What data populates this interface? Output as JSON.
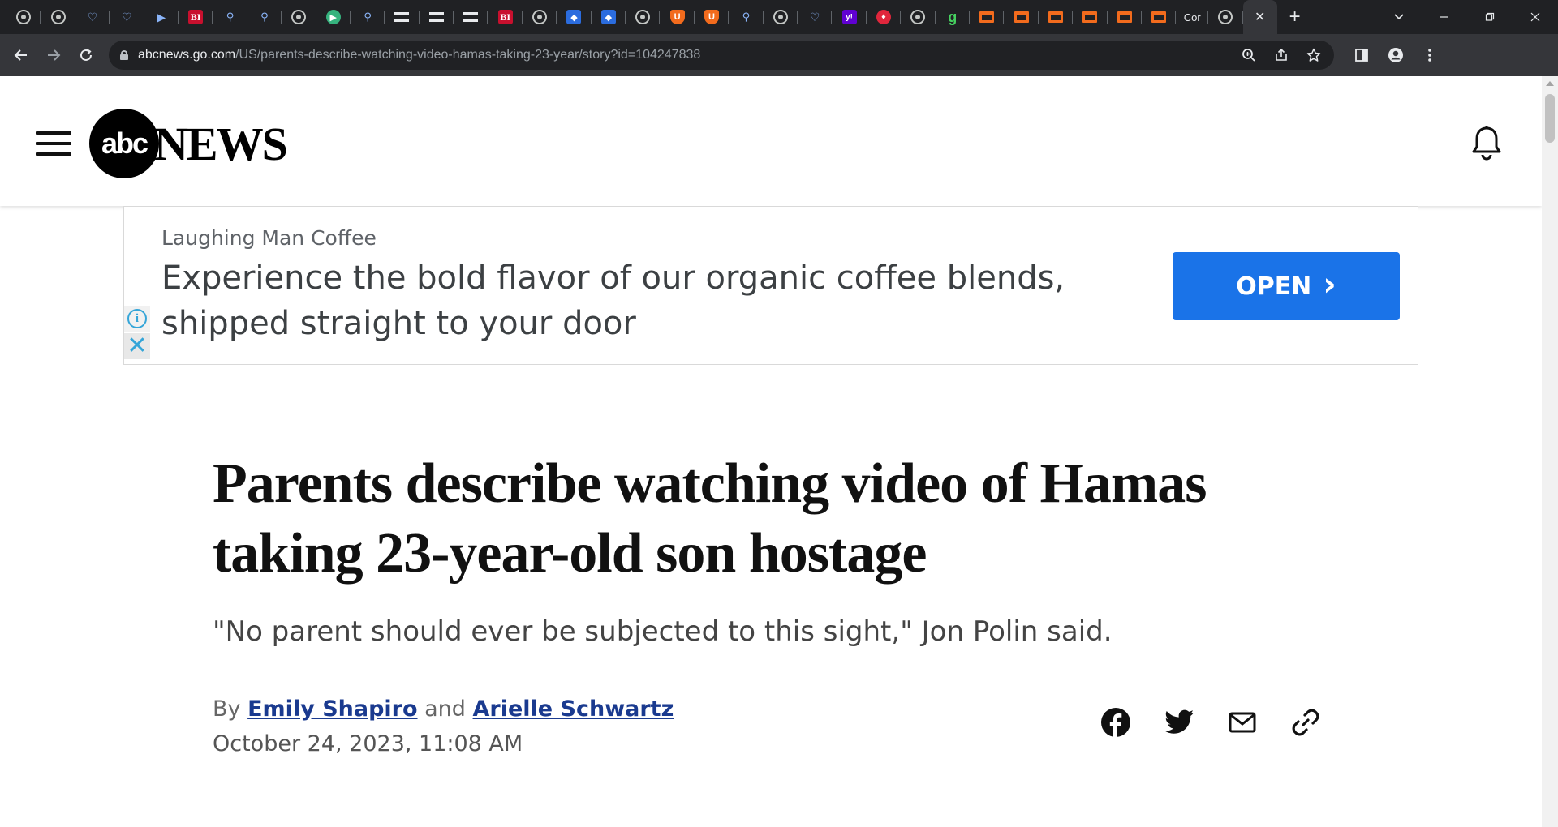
{
  "browser": {
    "tabs": [
      {
        "icon": "globe-icon",
        "glyph": ""
      },
      {
        "icon": "globe-icon",
        "glyph": ""
      },
      {
        "icon": "heart-icon",
        "glyph": "♡"
      },
      {
        "icon": "heart-icon",
        "glyph": "♡"
      },
      {
        "icon": "chevron-icon",
        "glyph": "▶"
      },
      {
        "icon": "business-insider-icon",
        "glyph": "BI"
      },
      {
        "icon": "search-icon",
        "glyph": "⚲"
      },
      {
        "icon": "search-icon",
        "glyph": "⚲"
      },
      {
        "icon": "globe-icon",
        "glyph": ""
      },
      {
        "icon": "play-icon",
        "glyph": "▶"
      },
      {
        "icon": "search-icon",
        "glyph": "⚲"
      },
      {
        "icon": "bookmark-icon",
        "glyph": ""
      },
      {
        "icon": "bookmark-icon",
        "glyph": ""
      },
      {
        "icon": "bookmark-icon",
        "glyph": ""
      },
      {
        "icon": "business-insider-icon",
        "glyph": "BI"
      },
      {
        "icon": "globe-icon",
        "glyph": ""
      },
      {
        "icon": "cube-icon",
        "glyph": "◆"
      },
      {
        "icon": "cube-icon",
        "glyph": "◆"
      },
      {
        "icon": "globe-icon",
        "glyph": ""
      },
      {
        "icon": "shield-icon",
        "glyph": "U"
      },
      {
        "icon": "shield-icon",
        "glyph": "U"
      },
      {
        "icon": "search-icon",
        "glyph": "⚲"
      },
      {
        "icon": "globe-icon",
        "glyph": ""
      },
      {
        "icon": "heart-icon",
        "glyph": "♡"
      },
      {
        "icon": "yahoo-icon",
        "glyph": "y!"
      },
      {
        "icon": "flame-icon",
        "glyph": "♦"
      },
      {
        "icon": "globe-icon",
        "glyph": ""
      },
      {
        "icon": "grammarly-icon",
        "glyph": "g"
      },
      {
        "icon": "substack-icon",
        "glyph": ""
      },
      {
        "icon": "substack-icon",
        "glyph": ""
      },
      {
        "icon": "substack-icon",
        "glyph": ""
      },
      {
        "icon": "substack-icon",
        "glyph": ""
      },
      {
        "icon": "substack-icon",
        "glyph": ""
      },
      {
        "icon": "substack-icon",
        "glyph": ""
      }
    ],
    "text_tab_label": "Cor",
    "active_tab_close": "✕",
    "new_tab": "+",
    "url_host": "abcnews.go.com",
    "url_path": "/US/parents-describe-watching-video-hamas-taking-23-year/story?id=104247838"
  },
  "site": {
    "logo_circle": "abc",
    "logo_wordmark": "NEWS"
  },
  "ad": {
    "advertiser": "Laughing Man Coffee",
    "headline": "Experience the bold flavor of our organic coffee blends, shipped straight to your door",
    "cta": "OPEN",
    "cta_arrow": "›",
    "info": "i",
    "close": "✕"
  },
  "article": {
    "headline": "Parents describe watching video of Hamas taking 23-year-old son hostage",
    "subhead": "\"No parent should ever be subjected to this sight,\" Jon Polin said.",
    "by_prefix": "By",
    "author1": "Emily Shapiro",
    "and_text": "and",
    "author2": "Arielle Schwartz",
    "date": "October 24, 2023, 11:08 AM"
  },
  "colors": {
    "cta_blue": "#1a73e8",
    "author_link": "#1a3a8f",
    "chrome_dark": "#202124"
  }
}
